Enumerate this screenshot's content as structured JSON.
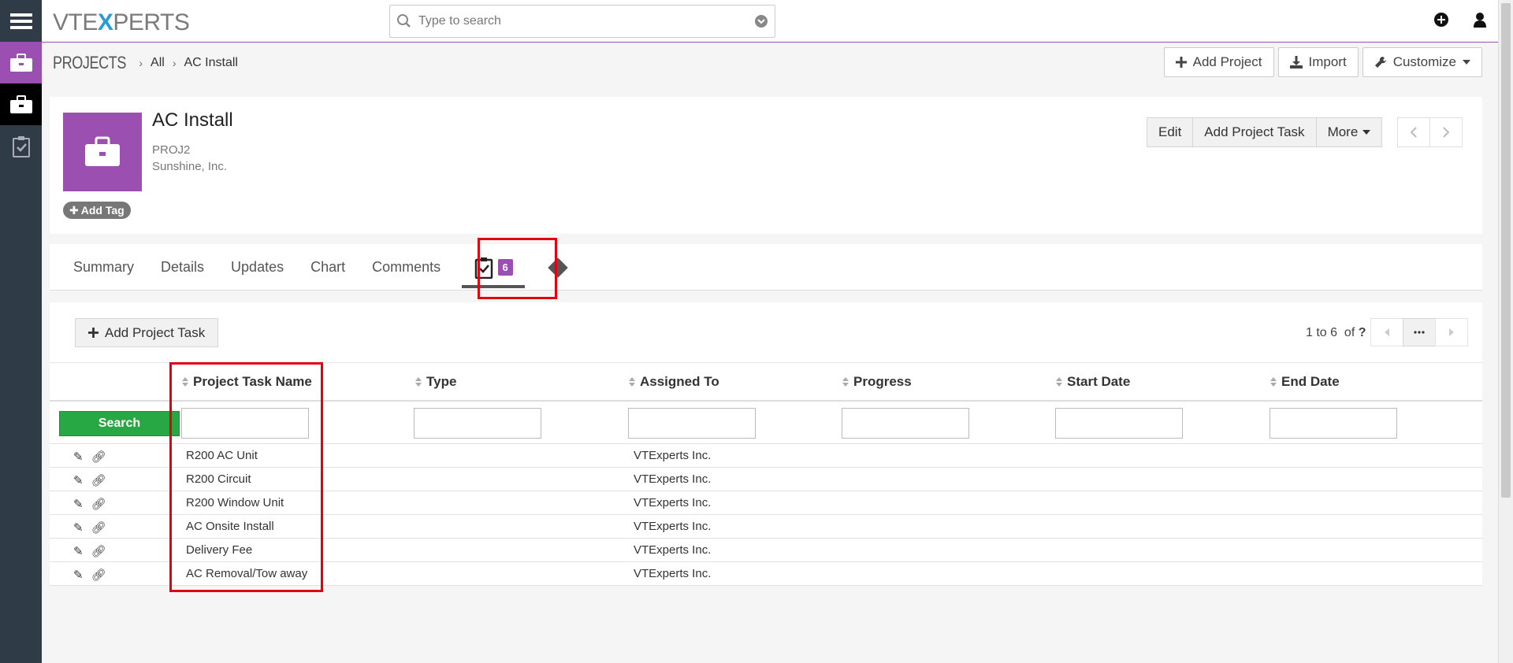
{
  "app": {
    "logo": {
      "left": "VTE",
      "x": "X",
      "right": "PERTS"
    },
    "search_placeholder": "Type to search"
  },
  "rail": {
    "items": [
      "menu-icon",
      "briefcase-icon",
      "briefcase-icon",
      "clipboard-check-icon"
    ]
  },
  "breadcrumb": {
    "module": "PROJECTS",
    "filter": "All",
    "record": "AC Install"
  },
  "header_buttons": {
    "add_project": "Add Project",
    "import": "Import",
    "customize": "Customize"
  },
  "record": {
    "title": "AC Install",
    "number": "PROJ2",
    "account": "Sunshine, Inc.",
    "add_tag": "Add Tag",
    "accent_color": "#9b4fb0"
  },
  "record_buttons": {
    "edit": "Edit",
    "add_project_task": "Add Project Task",
    "more": "More"
  },
  "tabs": {
    "summary": "Summary",
    "details": "Details",
    "updates": "Updates",
    "chart": "Chart",
    "comments": "Comments",
    "tasks_count": "6"
  },
  "list": {
    "add_task_label": "Add Project Task",
    "count_range": "1 to 6",
    "count_of": "of",
    "count_total": "?",
    "search_label": "Search",
    "columns": [
      "Project Task Name",
      "Type",
      "Assigned To",
      "Progress",
      "Start Date",
      "End Date"
    ],
    "rows": [
      {
        "name": "R200 AC Unit",
        "type": "",
        "assigned": "VTExperts Inc.",
        "progress": "",
        "start": "",
        "end": ""
      },
      {
        "name": "R200 Circuit",
        "type": "",
        "assigned": "VTExperts Inc.",
        "progress": "",
        "start": "",
        "end": ""
      },
      {
        "name": "R200 Window Unit",
        "type": "",
        "assigned": "VTExperts Inc.",
        "progress": "",
        "start": "",
        "end": ""
      },
      {
        "name": "AC Onsite Install",
        "type": "",
        "assigned": "VTExperts Inc.",
        "progress": "",
        "start": "",
        "end": ""
      },
      {
        "name": "Delivery Fee",
        "type": "",
        "assigned": "VTExperts Inc.",
        "progress": "",
        "start": "",
        "end": ""
      },
      {
        "name": "AC Removal/Tow away",
        "type": "",
        "assigned": "VTExperts Inc.",
        "progress": "",
        "start": "",
        "end": ""
      }
    ]
  },
  "colors": {
    "rail": "#2f3c48",
    "brand_purple": "#9b4fb0",
    "search_green": "#28a745",
    "highlight_red": "#e3000f"
  }
}
